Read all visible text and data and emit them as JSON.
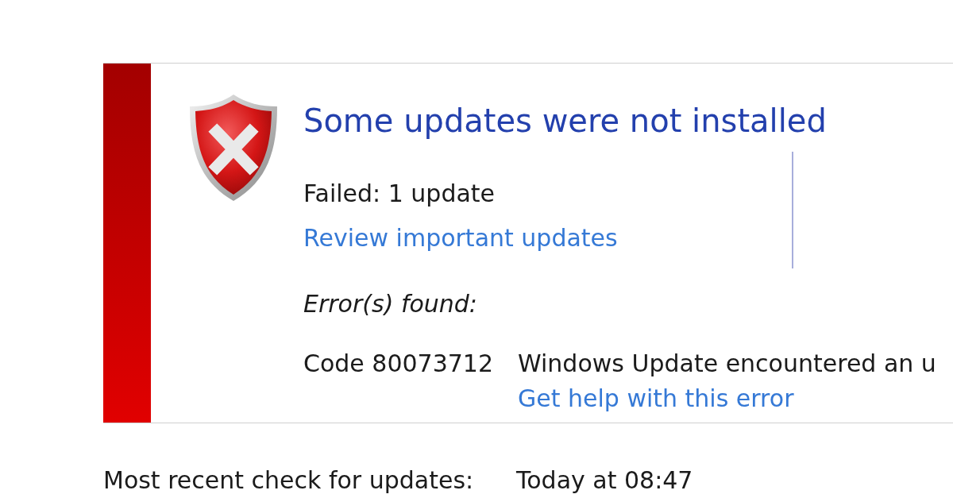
{
  "status_panel": {
    "title": "Some updates were not installed",
    "failed_summary": "Failed: 1 update",
    "review_link": "Review important updates",
    "errors_heading": "Error(s) found:",
    "errors": [
      {
        "code": "Code 80073712",
        "message": "Windows Update encountered an u",
        "help_link": "Get help with this error"
      }
    ]
  },
  "last_check": {
    "label": "Most recent check for updates:",
    "value": "Today at 08:47"
  }
}
